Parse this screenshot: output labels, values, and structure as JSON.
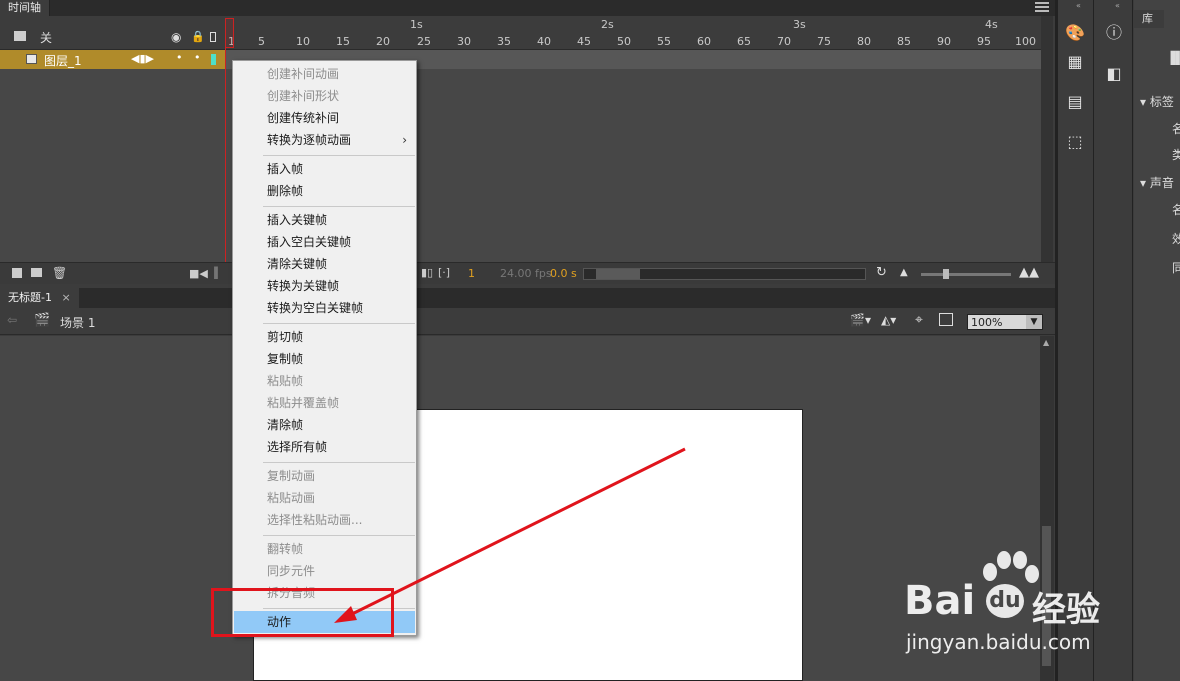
{
  "timeline": {
    "tab_label": "时间轴",
    "layer_group_label": "关",
    "layer_name": "图层_1",
    "ruler_seconds": [
      "1s",
      "2s",
      "3s",
      "4s"
    ],
    "ruler_frames": [
      "1",
      "5",
      "10",
      "15",
      "20",
      "25",
      "30",
      "35",
      "40",
      "45",
      "50",
      "55",
      "60",
      "65",
      "70",
      "75",
      "80",
      "85",
      "90",
      "95",
      "100"
    ],
    "current_frame": "1",
    "fps": "24.00 fps",
    "elapsed_time": "0.0 s"
  },
  "document": {
    "tab_label": "无标题-1",
    "scene_label": "场景 1",
    "zoom": "100%"
  },
  "right_panel": {
    "library_tab": "库",
    "label_section": "标签",
    "sound_section": "声音",
    "labels": [
      "名",
      "类",
      "名",
      "效",
      "同"
    ]
  },
  "context_menu": {
    "items": [
      {
        "label": "创建补间动画",
        "enabled": false
      },
      {
        "label": "创建补间形状",
        "enabled": false
      },
      {
        "label": "创建传统补间",
        "enabled": true
      },
      {
        "label": "转换为逐帧动画",
        "enabled": true,
        "submenu": true
      },
      {
        "label": "插入帧",
        "enabled": true
      },
      {
        "label": "删除帧",
        "enabled": true
      },
      {
        "label": "插入关键帧",
        "enabled": true
      },
      {
        "label": "插入空白关键帧",
        "enabled": true
      },
      {
        "label": "清除关键帧",
        "enabled": true
      },
      {
        "label": "转换为关键帧",
        "enabled": true
      },
      {
        "label": "转换为空白关键帧",
        "enabled": true
      },
      {
        "label": "剪切帧",
        "enabled": true
      },
      {
        "label": "复制帧",
        "enabled": true
      },
      {
        "label": "粘贴帧",
        "enabled": false
      },
      {
        "label": "粘贴并覆盖帧",
        "enabled": false
      },
      {
        "label": "清除帧",
        "enabled": true
      },
      {
        "label": "选择所有帧",
        "enabled": true
      },
      {
        "label": "复制动画",
        "enabled": false
      },
      {
        "label": "粘贴动画",
        "enabled": false
      },
      {
        "label": "选择性粘贴动画...",
        "enabled": false
      },
      {
        "label": "翻转帧",
        "enabled": false
      },
      {
        "label": "同步元件",
        "enabled": false
      },
      {
        "label": "拆分音频",
        "enabled": false
      },
      {
        "label": "动作",
        "enabled": true,
        "highlighted": true
      }
    ]
  },
  "watermark": {
    "brand": "Bai",
    "brand_tail": "经验",
    "url": "jingyan.baidu.com"
  },
  "colors": {
    "annotation_red": "#e0141c",
    "menu_highlight": "#91c9f7",
    "layer_highlight": "#b08b2a"
  }
}
